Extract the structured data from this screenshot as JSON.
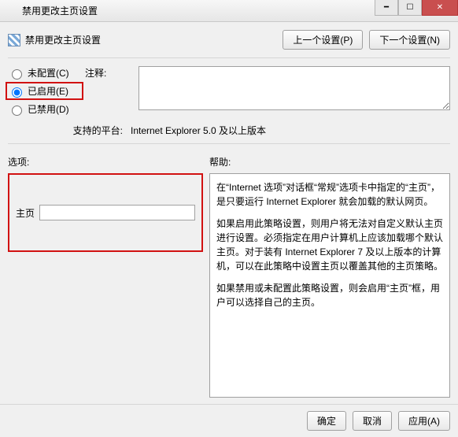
{
  "window": {
    "title": "禁用更改主页设置"
  },
  "header": {
    "title": "禁用更改主页设置",
    "prev_button": "上一个设置(P)",
    "next_button": "下一个设置(N)"
  },
  "radios": {
    "not_configured": "未配置(C)",
    "enabled": "已启用(E)",
    "disabled": "已禁用(D)",
    "selected": "enabled"
  },
  "comment": {
    "label": "注释:",
    "value": ""
  },
  "supported": {
    "label": "支持的平台:",
    "value": "Internet Explorer 5.0 及以上版本"
  },
  "sections": {
    "options_label": "选项:",
    "help_label": "帮助:"
  },
  "option_homepage": {
    "label": "主页",
    "value": ""
  },
  "help": {
    "p1": "在“Internet 选项”对话框“常规”选项卡中指定的“主页”，是只要运行 Internet Explorer 就会加载的默认网页。",
    "p2": "如果启用此策略设置，则用户将无法对自定义默认主页进行设置。必须指定在用户计算机上应该加载哪个默认主页。对于装有 Internet Explorer 7 及以上版本的计算机，可以在此策略中设置主页以覆盖其他的主页策略。",
    "p3": "如果禁用或未配置此策略设置，则会启用“主页”框，用户可以选择自己的主页。"
  },
  "footer": {
    "ok": "确定",
    "cancel": "取消",
    "apply": "应用(A)"
  }
}
